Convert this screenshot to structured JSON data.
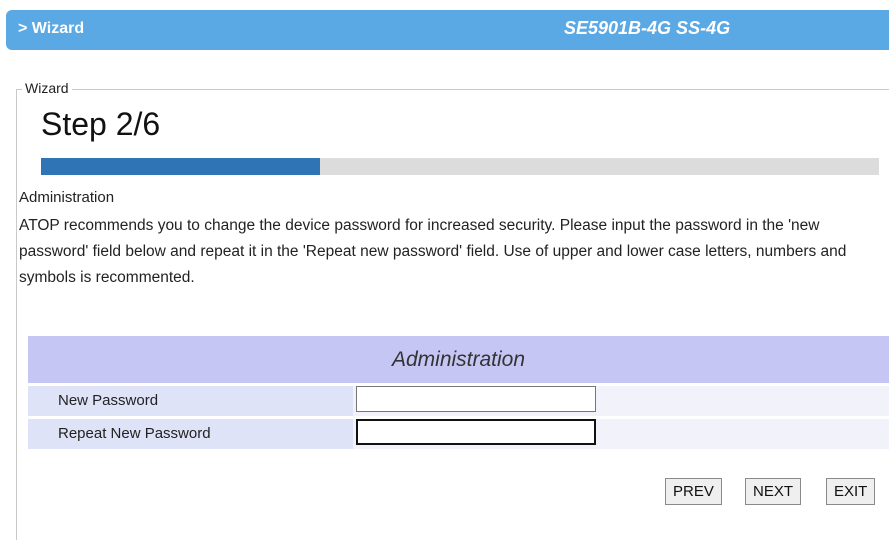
{
  "header": {
    "breadcrumb": "> Wizard",
    "model": "SE5901B-4G SS-4G",
    "color": "#5aa8e4"
  },
  "wizard": {
    "legend": "Wizard",
    "step_title": "Step 2/6",
    "progress_fraction": 0.333,
    "section_label": "Administration",
    "description": "ATOP recommends you to change the device password for increased security. Please input the password in the 'new password' field below and repeat it in the 'Repeat new password' field. Use of upper and lower case letters, numbers and symbols is recommented."
  },
  "admin_table": {
    "title": "Administration",
    "rows": [
      {
        "label": "New Password",
        "value": ""
      },
      {
        "label": "Repeat New Password",
        "value": ""
      }
    ]
  },
  "buttons": {
    "prev": "PREV",
    "next": "NEXT",
    "exit": "EXIT"
  }
}
